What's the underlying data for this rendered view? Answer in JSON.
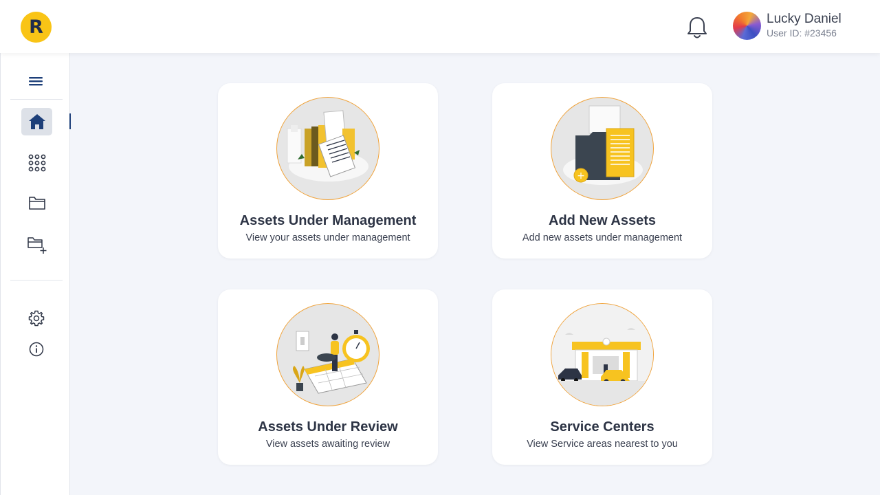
{
  "header": {
    "logo_letter": "R",
    "user_name": "Lucky Daniel",
    "user_id": "User ID: #23456"
  },
  "sidebar": {
    "items": [
      {
        "icon": "menu-icon"
      },
      {
        "icon": "home-icon",
        "active": true
      },
      {
        "icon": "grid-icon"
      },
      {
        "icon": "folder-icon"
      },
      {
        "icon": "folder-add-icon"
      },
      {
        "icon": "gear-icon"
      },
      {
        "icon": "info-icon"
      }
    ]
  },
  "cards": [
    {
      "title": "Assets Under Management",
      "subtitle": "View your assets under management"
    },
    {
      "title": "Add New Assets",
      "subtitle": "Add new assets under management"
    },
    {
      "title": "Assets Under Review",
      "subtitle": "View assets awaiting review"
    },
    {
      "title": "Service Centers",
      "subtitle": "View Service areas nearest to you"
    }
  ],
  "colors": {
    "accent": "#f9c416",
    "navy": "#1d3f79",
    "background": "#f3f5fa",
    "illustration_border": "#f0a33b"
  }
}
